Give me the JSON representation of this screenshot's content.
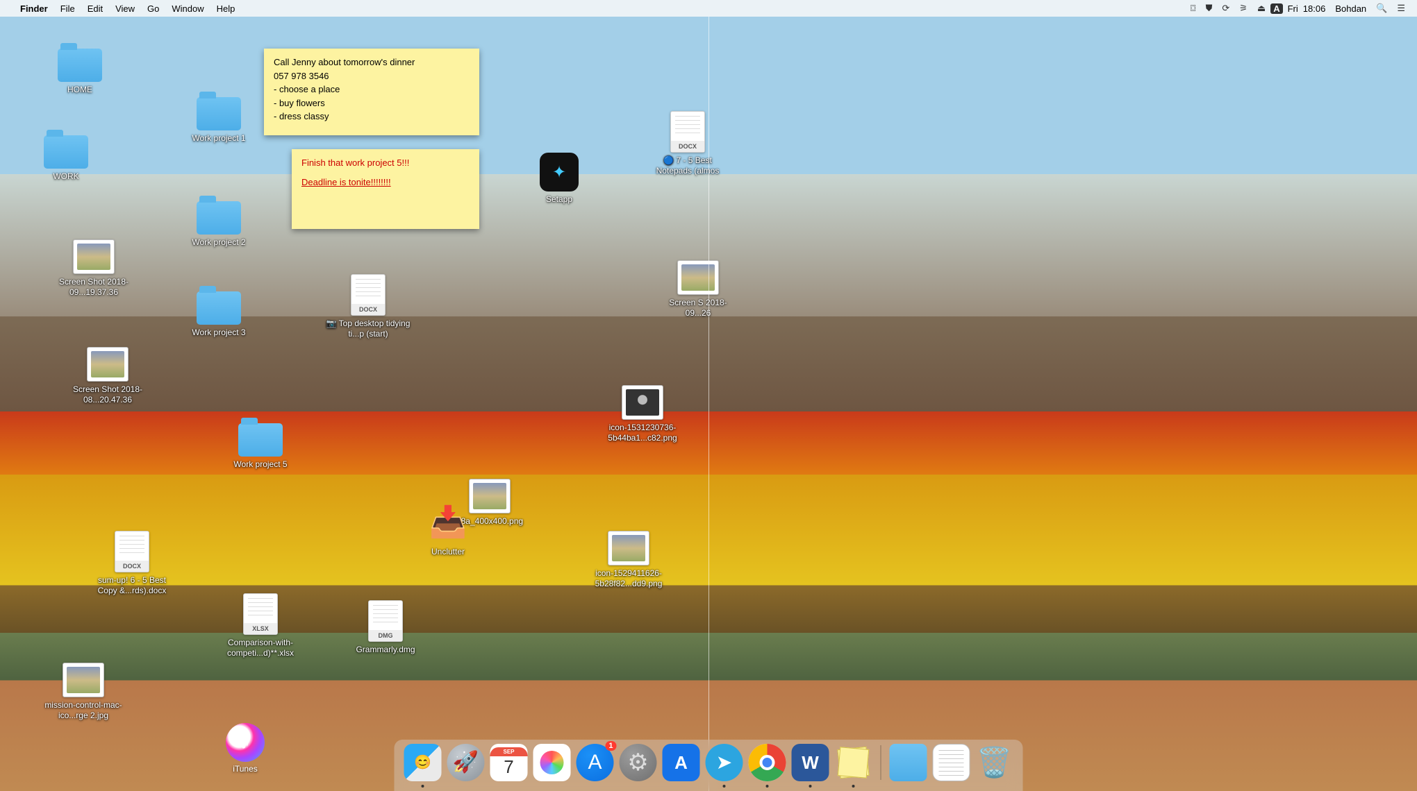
{
  "menubar": {
    "app_name": "Finder",
    "items": [
      "File",
      "Edit",
      "View",
      "Go",
      "Window",
      "Help"
    ],
    "status": {
      "day": "Fri",
      "time": "18:06",
      "user": "Bohdan",
      "input_badge": "A"
    }
  },
  "stickies": [
    {
      "lines": [
        "Call Jenny about tomorrow's dinner",
        "057 978 3546",
        "- choose a place",
        "- buy flowers",
        "- dress classy"
      ]
    },
    {
      "lines": [
        "Finish that work project 5!!!",
        "Deadline is tonite!!!!!!!!"
      ]
    }
  ],
  "desktop": {
    "folders": [
      {
        "label": "HOME"
      },
      {
        "label": "WORK"
      },
      {
        "label": "Work project 1"
      },
      {
        "label": "Work project 2"
      },
      {
        "label": "Work project 3"
      },
      {
        "label": "Work project 5"
      }
    ],
    "files": [
      {
        "label": "Screen Shot 2018-09...19.37.36",
        "type": "img"
      },
      {
        "label": "Screen Shot 2018-08...20.47.36",
        "type": "img"
      },
      {
        "label": "sum-up! 6 - 5 Best Copy &...rds).docx",
        "type": "docx"
      },
      {
        "label": "Comparison-with-competi...d)**.xlsx",
        "type": "xlsx"
      },
      {
        "label": "mission-control-mac-ico...rge 2.jpg",
        "type": "img"
      },
      {
        "label": "📷 Top desktop tidying ti...p (start)",
        "type": "docx"
      },
      {
        "label": "Grammarly.dmg",
        "type": "dmg"
      },
      {
        "label": "38a_400x400.png",
        "type": "img"
      },
      {
        "label": "icon-1531230736-5b44ba1...c82.png",
        "type": "img-dark"
      },
      {
        "label": "icon-1529411626-5b28f82...dd9.png",
        "type": "img"
      },
      {
        "label": "🔵 7 - 5 Best Notepads (almos",
        "type": "docx"
      },
      {
        "label": "Screen S 2018-09...26",
        "type": "img"
      }
    ],
    "apps": [
      {
        "label": "Setapp"
      },
      {
        "label": "Unclutter"
      },
      {
        "label": "iTunes"
      }
    ]
  },
  "dock": {
    "apps": [
      {
        "name": "finder",
        "color1": "#2aa9f5",
        "color2": "#eaeaea",
        "running": true
      },
      {
        "name": "launchpad",
        "color1": "#c6ccd2",
        "color2": "#8a9299",
        "round": true
      },
      {
        "name": "calendar",
        "color1": "#ffffff",
        "color2": "#ec5342",
        "text_top": "SEP",
        "text_main": "7"
      },
      {
        "name": "photos",
        "color1": "#ffffff",
        "color2": "#ffffff",
        "round": true
      },
      {
        "name": "appstore",
        "color1": "#1b90f7",
        "color2": "#0b6fe0",
        "round": true,
        "notif": "1"
      },
      {
        "name": "system-preferences",
        "color1": "#9c9c9c",
        "color2": "#6f6f6f",
        "round": true
      },
      {
        "name": "app-a",
        "color1": "#1572e8",
        "color2": "#1572e8",
        "text_main": "A"
      },
      {
        "name": "telegram",
        "color1": "#2ca5e0",
        "color2": "#2ca5e0",
        "round": true,
        "running": true
      },
      {
        "name": "chrome",
        "color1": "#ffffff",
        "color2": "#ffffff",
        "round": true,
        "running": true
      },
      {
        "name": "word",
        "color1": "#2b579a",
        "color2": "#2b579a",
        "text_main": "W",
        "running": true
      },
      {
        "name": "stickies",
        "color1": "#f7e06a",
        "color2": "#f1d34a",
        "running": true
      }
    ],
    "right": [
      {
        "name": "downloads-folder"
      },
      {
        "name": "document-stack"
      },
      {
        "name": "trash"
      }
    ]
  },
  "colors": {
    "sticky_bg": "#fdf3a1",
    "folder": "#5bb6ea"
  }
}
